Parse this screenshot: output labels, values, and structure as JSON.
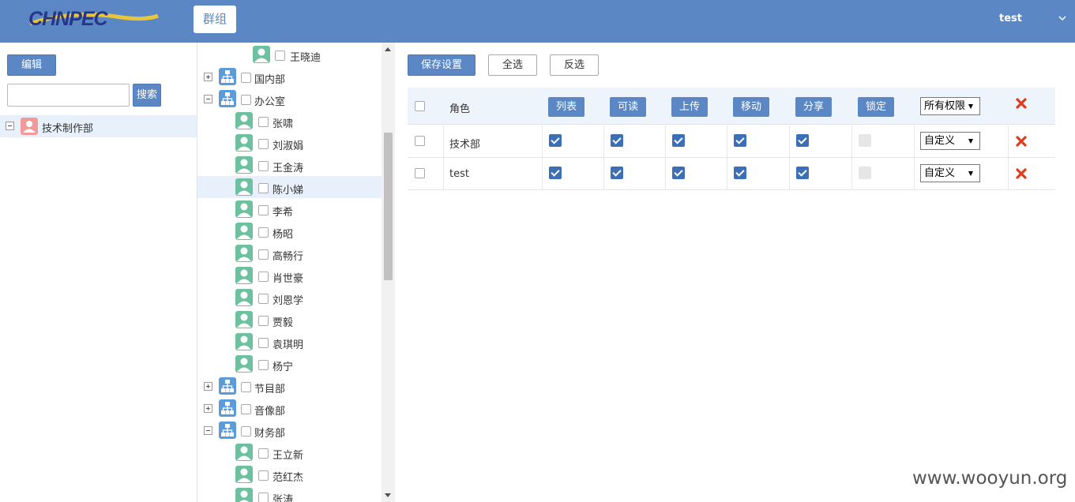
{
  "header": {
    "logo_text": "CHNPEC",
    "nav_tab": "群组",
    "user": "test",
    "colors": {
      "header_bg": "#5b88c4",
      "logo_blue": "#26348a",
      "logo_yellow": "#e7c63b"
    }
  },
  "left": {
    "edit_label": "编辑",
    "search_placeholder": "",
    "search_label": "搜索",
    "root_label": "技术制作部"
  },
  "tree": {
    "items": [
      {
        "label": "王晓迪",
        "type": "person"
      },
      {
        "label": "国内部",
        "type": "org",
        "expand": "plus"
      },
      {
        "label": "办公室",
        "type": "org",
        "expand": "minus"
      },
      {
        "label": "张啸",
        "type": "person"
      },
      {
        "label": "刘淑娟",
        "type": "person"
      },
      {
        "label": "王金涛",
        "type": "person"
      },
      {
        "label": "陈小娣",
        "type": "person",
        "selected": true
      },
      {
        "label": "李希",
        "type": "person"
      },
      {
        "label": "杨昭",
        "type": "person"
      },
      {
        "label": "高畅行",
        "type": "person"
      },
      {
        "label": "肖世豪",
        "type": "person"
      },
      {
        "label": "刘恩学",
        "type": "person"
      },
      {
        "label": "贾毅",
        "type": "person"
      },
      {
        "label": "袁琪明",
        "type": "person"
      },
      {
        "label": "杨宁",
        "type": "person"
      },
      {
        "label": "节目部",
        "type": "org",
        "expand": "plus"
      },
      {
        "label": "音像部",
        "type": "org",
        "expand": "plus"
      },
      {
        "label": "财务部",
        "type": "org",
        "expand": "minus"
      },
      {
        "label": "王立新",
        "type": "person"
      },
      {
        "label": "范红杰",
        "type": "person"
      },
      {
        "label": "张涛",
        "type": "person"
      }
    ]
  },
  "toolbar": {
    "save_label": "保存设置",
    "select_all_label": "全选",
    "invert_label": "反选"
  },
  "table": {
    "role_header": "角色",
    "perm_headers": [
      "列表",
      "可读",
      "上传",
      "移动",
      "分享",
      "锁定"
    ],
    "header_select": "所有权限",
    "rows": [
      {
        "role": "技术部",
        "perms": [
          true,
          true,
          true,
          true,
          true,
          false
        ],
        "select": "自定义"
      },
      {
        "role": "test",
        "perms": [
          true,
          true,
          true,
          true,
          true,
          false
        ],
        "select": "自定义"
      }
    ],
    "colors": {
      "checked": "#3d6fb6",
      "delete_red": "#e03a1e"
    }
  },
  "watermark": "www.wooyun.org"
}
